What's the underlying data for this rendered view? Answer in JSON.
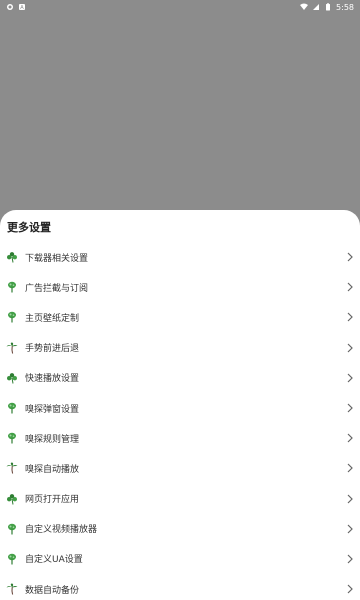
{
  "status_bar": {
    "time": "5:58",
    "icons": [
      "notification-icon",
      "android-icon",
      "wifi-icon",
      "battery-icon"
    ]
  },
  "sheet": {
    "title": "更多设置",
    "items": [
      {
        "label": "下载器相关设置",
        "icon": "clover-icon"
      },
      {
        "label": "广告拦截与订阅",
        "icon": "sprout-icon"
      },
      {
        "label": "主页壁纸定制",
        "icon": "sprout-icon"
      },
      {
        "label": "手势前进后退",
        "icon": "palm-icon"
      },
      {
        "label": "快速播放设置",
        "icon": "clover-icon"
      },
      {
        "label": "嗅探弹窗设置",
        "icon": "sprout-icon"
      },
      {
        "label": "嗅探规则管理",
        "icon": "sprout-icon"
      },
      {
        "label": "嗅探自动播放",
        "icon": "palm-icon"
      },
      {
        "label": "网页打开应用",
        "icon": "clover-icon"
      },
      {
        "label": "自定义视频播放器",
        "icon": "sprout-icon"
      },
      {
        "label": "自定义UA设置",
        "icon": "sprout-icon"
      },
      {
        "label": "数据自动备份",
        "icon": "palm-icon"
      }
    ]
  },
  "colors": {
    "backdrop": "#8c8c8c",
    "sheet": "#ffffff",
    "icon_green": "#2e7d32"
  }
}
